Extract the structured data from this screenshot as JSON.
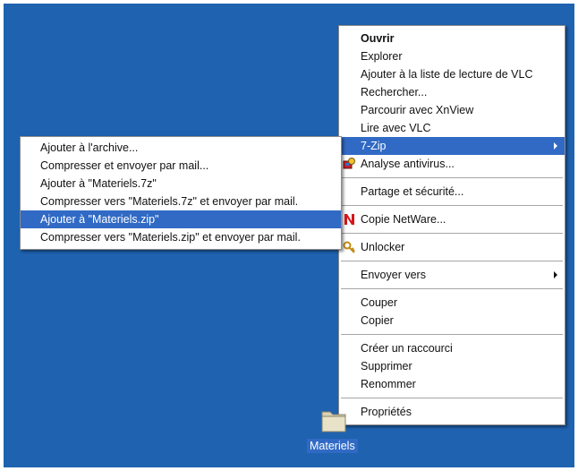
{
  "colors": {
    "desktop": "#1e62b0",
    "highlight": "#316ac5",
    "menu_bg": "#ffffff"
  },
  "context_menu": {
    "items": [
      {
        "label": "Ouvrir"
      },
      {
        "label": "Explorer"
      },
      {
        "label": "Ajouter à la liste de lecture de VLC"
      },
      {
        "label": "Rechercher..."
      },
      {
        "label": "Parcourir avec XnView"
      },
      {
        "label": "Lire avec VLC"
      },
      {
        "label": "7-Zip"
      },
      {
        "label": "Analyse antivirus...",
        "icon": "antivirus-icon"
      },
      {
        "label": "Partage et sécurité..."
      },
      {
        "label": "Copie NetWare...",
        "icon": "netware-icon"
      },
      {
        "label": "Unlocker",
        "icon": "unlocker-icon"
      },
      {
        "label": "Envoyer vers"
      },
      {
        "label": "Couper"
      },
      {
        "label": "Copier"
      },
      {
        "label": "Créer un raccourci"
      },
      {
        "label": "Supprimer"
      },
      {
        "label": "Renommer"
      },
      {
        "label": "Propriétés"
      }
    ]
  },
  "submenu_7zip": {
    "items": [
      {
        "label": "Ajouter à l'archive..."
      },
      {
        "label": "Compresser et envoyer par mail..."
      },
      {
        "label": "Ajouter à \"Materiels.7z\""
      },
      {
        "label": "Compresser vers \"Materiels.7z\" et envoyer par mail."
      },
      {
        "label": "Ajouter à \"Materiels.zip\""
      },
      {
        "label": "Compresser vers \"Materiels.zip\" et envoyer par mail."
      }
    ]
  },
  "desktop_icon": {
    "label": "Materiels",
    "icon": "folder-icon"
  }
}
